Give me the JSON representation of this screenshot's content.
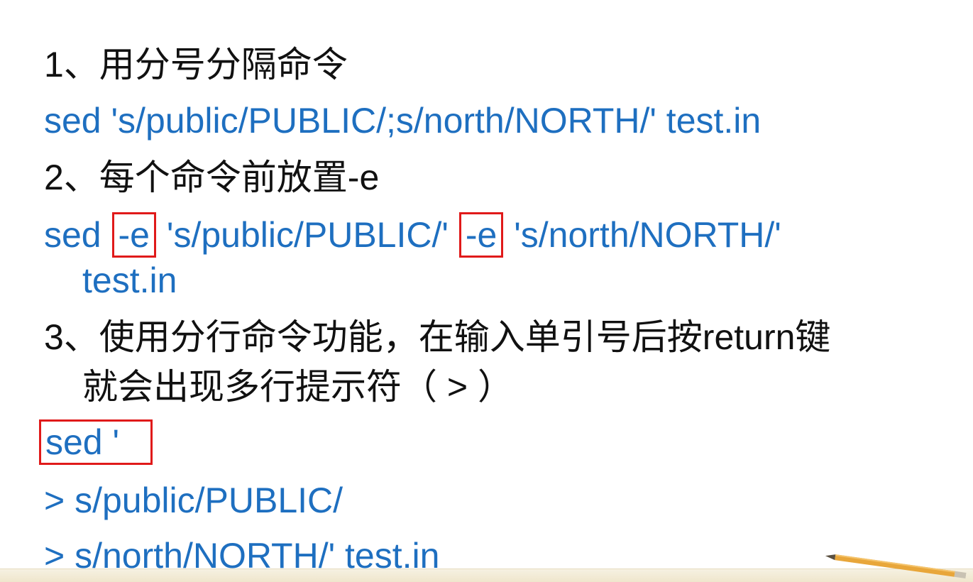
{
  "items": [
    {
      "heading": "1、用分号分隔命令",
      "code": "sed 's/public/PUBLIC/;s/north/NORTH/' test.in"
    },
    {
      "heading": "2、每个命令前放置-e",
      "code_prefix": "sed",
      "flag1": "-e",
      "arg1": "'s/public/PUBLIC/'",
      "flag2": "-e",
      "arg2": "'s/north/NORTH/'",
      "code_cont": "test.in"
    },
    {
      "heading_line1": "3、使用分行命令功能，在输入单引号后按return键",
      "heading_line2": "就会出现多行提示符（ > ）",
      "prompt_box": "sed '",
      "line1": "> s/public/PUBLIC/",
      "line2": "> s/north/NORTH/' test.in"
    }
  ],
  "colors": {
    "heading": "#111111",
    "code": "#1e6fc0",
    "highlight_box": "#e01a1a"
  }
}
